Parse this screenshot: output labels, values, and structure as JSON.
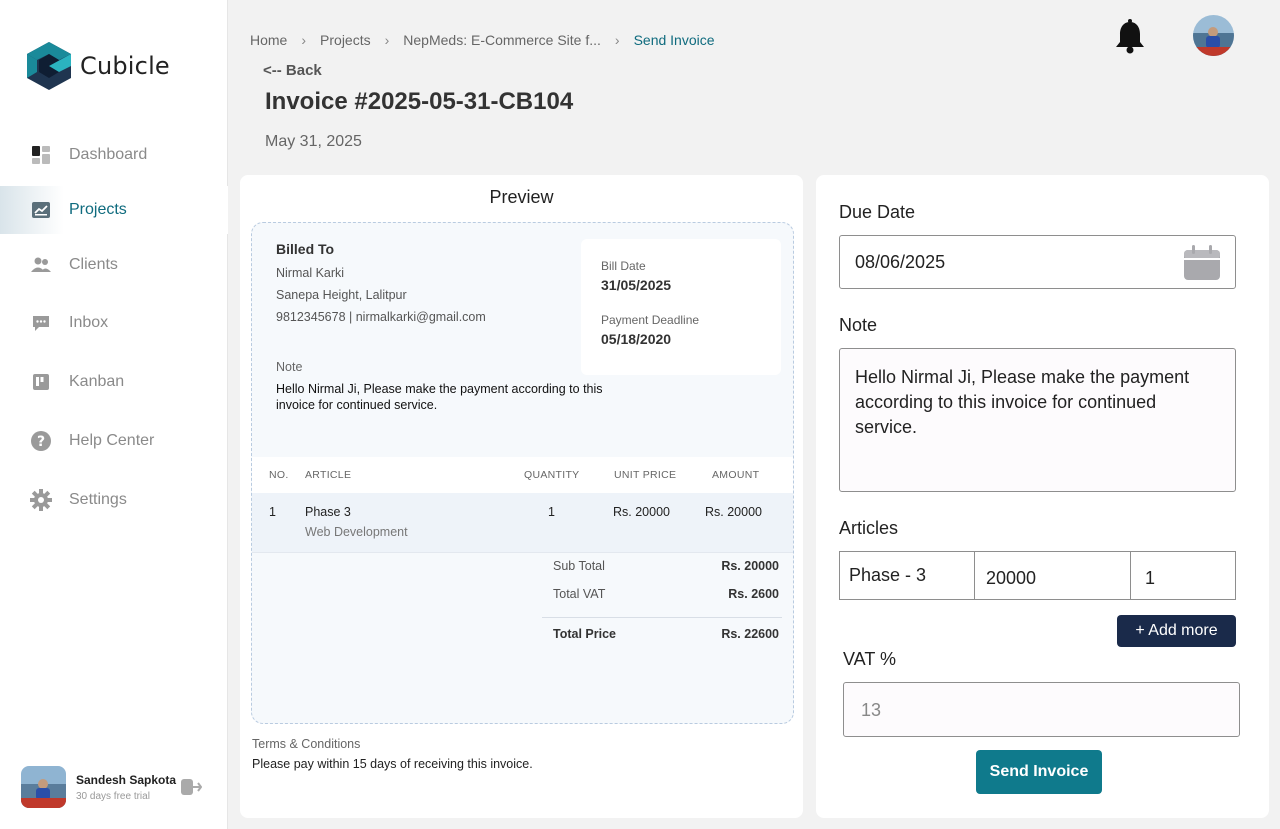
{
  "brand": {
    "name": "Cubicle"
  },
  "sidebar": {
    "items": [
      {
        "label": "Dashboard"
      },
      {
        "label": "Projects"
      },
      {
        "label": "Clients"
      },
      {
        "label": "Inbox"
      },
      {
        "label": "Kanban"
      },
      {
        "label": "Help Center"
      },
      {
        "label": "Settings"
      }
    ],
    "active_item": "Projects",
    "user": {
      "name": "Sandesh Sapkota",
      "subtitle": "30 days free trial"
    }
  },
  "breadcrumb": [
    "Home",
    "Projects",
    "NepMeds: E-Commerce Site f...",
    "Send Invoice"
  ],
  "header": {
    "back_label": "<-- Back",
    "invoice_title": "Invoice #2025-05-31-CB104",
    "invoice_date": "May 31, 2025"
  },
  "preview": {
    "heading": "Preview",
    "billed_to": {
      "title": "Billed To",
      "name": "Nirmal Karki",
      "address": "Sanepa Height, Lalitpur",
      "contact": "9812345678 | nirmalkarki@gmail.com"
    },
    "bill_date_label": "Bill Date",
    "bill_date": "31/05/2025",
    "deadline_label": "Payment Deadline",
    "deadline": "05/18/2020",
    "note_label": "Note",
    "note_text": "Hello Nirmal Ji, Please make the payment according to this invoice  for continued service.",
    "columns": [
      "NO.",
      "ARTICLE",
      "QUANTITY",
      "UNIT PRICE",
      "AMOUNT"
    ],
    "rows": [
      {
        "no": "1",
        "article": "Phase 3",
        "article_sub": "Web Development",
        "quantity": "1",
        "unit_price": "Rs. 20000",
        "amount": "Rs. 20000"
      }
    ],
    "subtotal_label": "Sub Total",
    "subtotal": "Rs. 20000",
    "vat_label": "Total VAT",
    "vat": "Rs. 2600",
    "total_label": "Total Price",
    "total": "Rs. 22600",
    "terms_label": "Terms & Conditions",
    "terms_text": "Please pay within 15 days of receiving this invoice."
  },
  "form": {
    "due_date_label": "Due Date",
    "due_date_value": "08/06/2025",
    "note_label": "Note",
    "note_value": "Hello Nirmal Ji, Please make the payment according to this invoice  for continued service.",
    "articles_label": "Articles",
    "article_name": "Phase - 3",
    "article_price": "20000",
    "article_qty": "1",
    "add_more_label": "+ Add more",
    "vat_label": "VAT %",
    "vat_placeholder": "13",
    "send_label": "Send Invoice"
  },
  "colors": {
    "accent": "#0f7a8c",
    "active_nav": "#0f6b7e",
    "dark_button": "#1a2a4a"
  }
}
